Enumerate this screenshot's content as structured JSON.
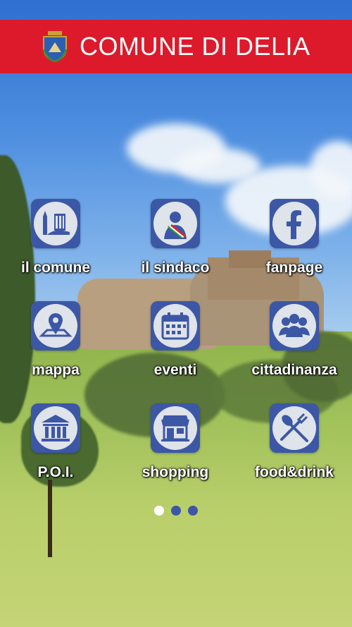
{
  "header": {
    "title": "COMUNE DI DELIA",
    "crest_icon": "municipal-crest"
  },
  "menu": [
    {
      "label": "il comune",
      "icon": "town-buildings-icon"
    },
    {
      "label": "il sindaco",
      "icon": "mayor-icon"
    },
    {
      "label": "fanpage",
      "icon": "facebook-icon"
    },
    {
      "label": "mappa",
      "icon": "map-pin-icon"
    },
    {
      "label": "eventi",
      "icon": "calendar-icon"
    },
    {
      "label": "cittadinanza",
      "icon": "people-icon"
    },
    {
      "label": "P.O.I.",
      "icon": "monument-icon"
    },
    {
      "label": "shopping",
      "icon": "shop-icon"
    },
    {
      "label": "food&drink",
      "icon": "fork-spoon-icon"
    }
  ],
  "pager": {
    "pages": 3,
    "active": 1
  },
  "colors": {
    "header": "#dc1a2b",
    "tile": "#3c57a6",
    "label": "#ffffff"
  }
}
